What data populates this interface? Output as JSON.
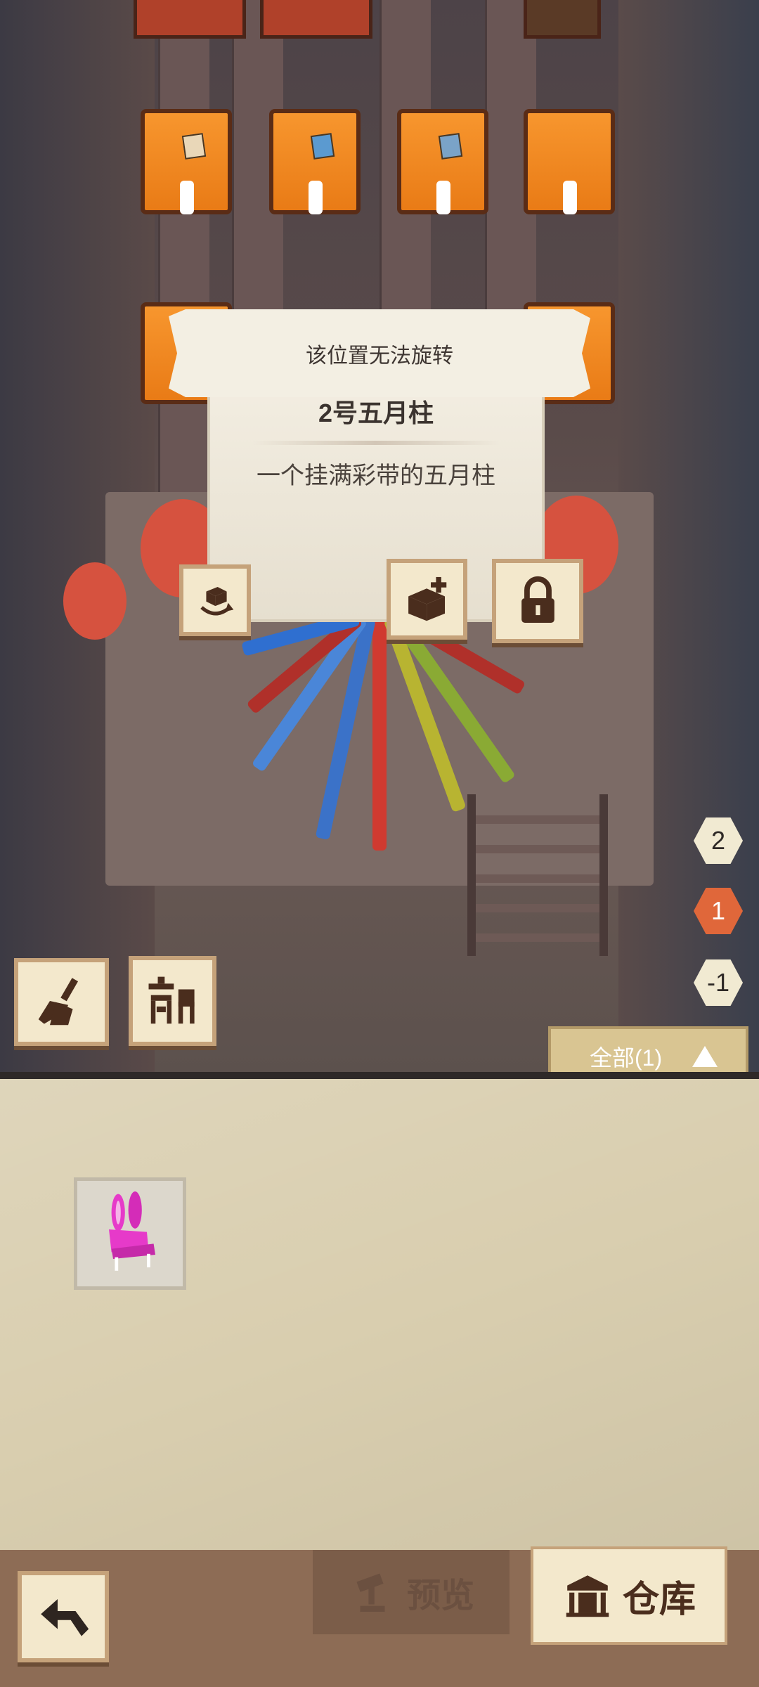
{
  "toast": {
    "message": "该位置无法旋转"
  },
  "item_card": {
    "title": "2号五月柱",
    "description": "一个挂满彩带的五月柱"
  },
  "item_actions": [
    {
      "name": "rotate-icon"
    },
    {
      "name": "store-box-icon"
    },
    {
      "name": "lock-icon"
    }
  ],
  "levels": [
    {
      "label": "2",
      "active": false
    },
    {
      "label": "1",
      "active": true
    },
    {
      "label": "-1",
      "active": false
    }
  ],
  "tools": [
    {
      "name": "broom-icon"
    },
    {
      "name": "furniture-icon"
    }
  ],
  "filter": {
    "label": "全部(1)"
  },
  "inventory": {
    "items": [
      {
        "name": "bunny-chair-icon"
      }
    ]
  },
  "bottom_bar": {
    "back_icon": "back-arrow-icon",
    "preview_label": "预览",
    "storage_label": "仓库"
  },
  "colors": {
    "accent": "#e0673a",
    "panel": "#d9ceaf",
    "bar": "#8d6c55"
  }
}
